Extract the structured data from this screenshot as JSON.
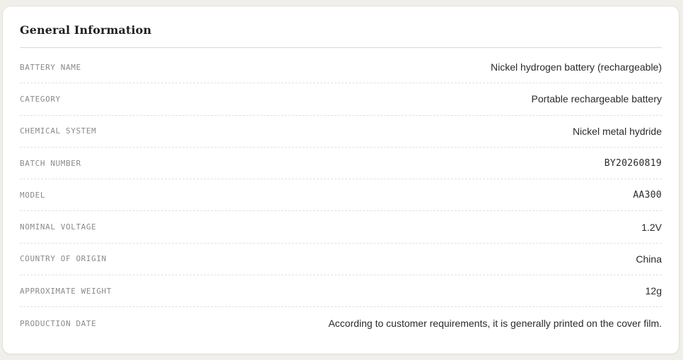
{
  "section": {
    "title": "General Information"
  },
  "rows": [
    {
      "label": "BATTERY NAME",
      "value": "Nickel hydrogen battery (rechargeable)"
    },
    {
      "label": "CATEGORY",
      "value": "Portable rechargeable battery"
    },
    {
      "label": "CHEMICAL SYSTEM",
      "value": "Nickel metal hydride"
    },
    {
      "label": "BATCH NUMBER",
      "value": "BY20260819"
    },
    {
      "label": "MODEL",
      "value": "AA300"
    },
    {
      "label": "NOMINAL VOLTAGE",
      "value": "1.2V"
    },
    {
      "label": "COUNTRY OF ORIGIN",
      "value": "China"
    },
    {
      "label": "APPROXIMATE WEIGHT",
      "value": "12g"
    },
    {
      "label": "PRODUCTION DATE",
      "value": "According to customer requirements, it is generally printed on the cover film."
    }
  ]
}
